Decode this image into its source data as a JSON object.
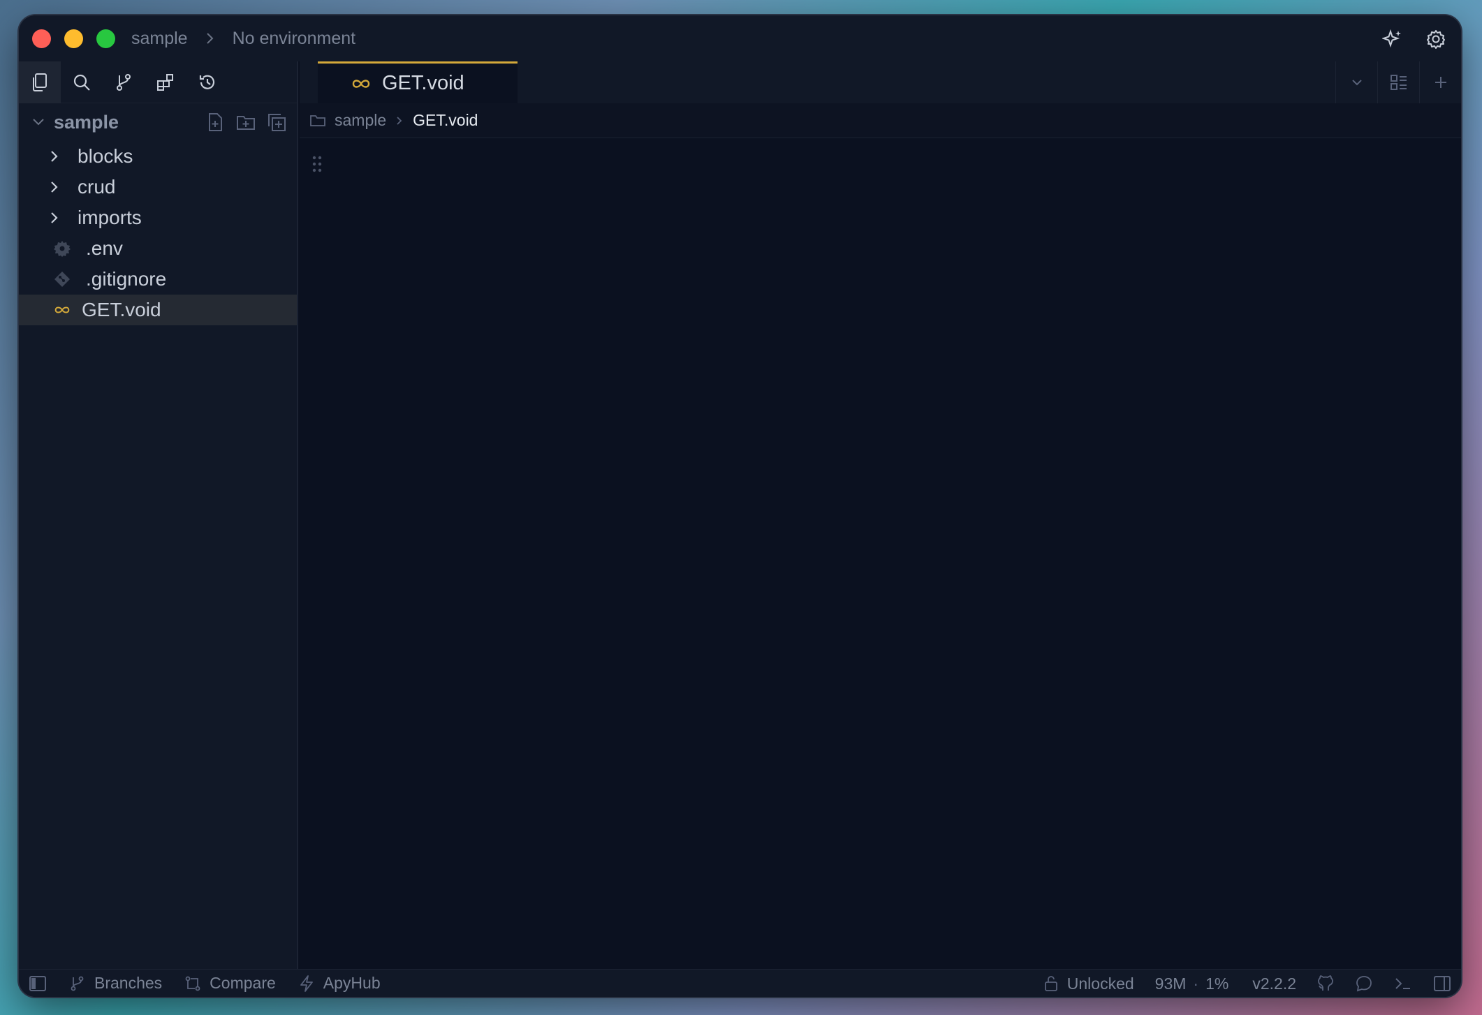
{
  "titlebar": {
    "workspace": "sample",
    "environment": "No environment"
  },
  "tab": {
    "label": "GET.void"
  },
  "breadcrumb": {
    "folder": "sample",
    "file": "GET.void"
  },
  "sidebar": {
    "root": "sample",
    "items": [
      {
        "label": "blocks",
        "kind": "folder"
      },
      {
        "label": "crud",
        "kind": "folder"
      },
      {
        "label": "imports",
        "kind": "folder"
      },
      {
        "label": ".env",
        "kind": "file",
        "icon": "gear-icon"
      },
      {
        "label": ".gitignore",
        "kind": "file",
        "icon": "git-icon"
      },
      {
        "label": "GET.void",
        "kind": "file",
        "icon": "infinity-icon",
        "selected": true
      }
    ]
  },
  "statusbar": {
    "branches": "Branches",
    "compare": "Compare",
    "apyhub": "ApyHub",
    "lock": "Unlocked",
    "memory": "93M",
    "cpu": "1%",
    "version": "v2.2.2"
  },
  "colors": {
    "accent": "#d4a93a",
    "background": "#0b1120",
    "panel": "#111827"
  }
}
